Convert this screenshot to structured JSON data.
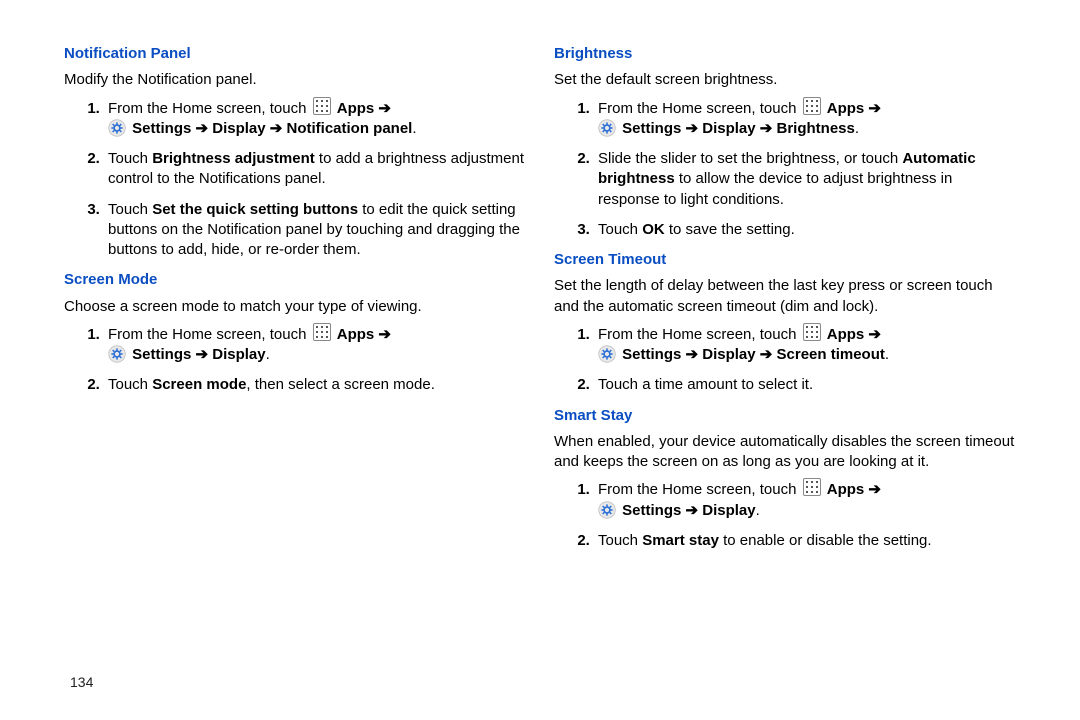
{
  "page_number": "134",
  "arrow": " ➔ ",
  "icons": {
    "apps": "apps-icon",
    "settings": "settings-icon"
  },
  "left": {
    "s1": {
      "title": "Notification Panel",
      "intro": "Modify the Notification panel.",
      "step1_a": "From the Home screen, touch ",
      "step1_apps": "Apps",
      "step1_nav": "Settings ➔ Display ➔ Notification panel",
      "step2_a": "Touch ",
      "step2_b": "Brightness adjustment",
      "step2_c": " to add a brightness adjustment control to the Notifications panel.",
      "step3_a": "Touch ",
      "step3_b": "Set the quick setting buttons",
      "step3_c": " to edit the quick setting buttons on the Notification panel by touching and dragging the buttons to add, hide, or re-order them."
    },
    "s2": {
      "title": "Screen Mode",
      "intro": "Choose a screen mode to match your type of viewing.",
      "step1_a": "From the Home screen, touch ",
      "step1_apps": "Apps",
      "step1_nav": "Settings ➔ Display",
      "step2_a": "Touch ",
      "step2_b": "Screen mode",
      "step2_c": ", then select a screen mode."
    }
  },
  "right": {
    "s1": {
      "title": "Brightness",
      "intro": "Set the default screen brightness.",
      "step1_a": "From the Home screen, touch ",
      "step1_apps": "Apps",
      "step1_nav": "Settings ➔ Display ➔ Brightness",
      "step2_a": "Slide the slider to set the brightness, or touch ",
      "step2_b": "Automatic brightness",
      "step2_c": " to allow the device to adjust brightness in response to light conditions.",
      "step3_a": "Touch ",
      "step3_b": "OK",
      "step3_c": " to save the setting."
    },
    "s2": {
      "title": "Screen Timeout",
      "intro": "Set the length of delay between the last key press or screen touch and the automatic screen timeout (dim and lock).",
      "step1_a": "From the Home screen, touch ",
      "step1_apps": "Apps",
      "step1_nav": "Settings ➔ Display ➔ Screen timeout",
      "step2": "Touch a time amount to select it."
    },
    "s3": {
      "title": "Smart Stay",
      "intro": "When enabled, your device automatically disables the screen timeout and keeps the screen on as long as you are looking at it.",
      "step1_a": "From the Home screen, touch ",
      "step1_apps": "Apps",
      "step1_nav": "Settings ➔ Display",
      "step2_a": "Touch ",
      "step2_b": "Smart stay",
      "step2_c": " to enable or disable the setting."
    }
  }
}
